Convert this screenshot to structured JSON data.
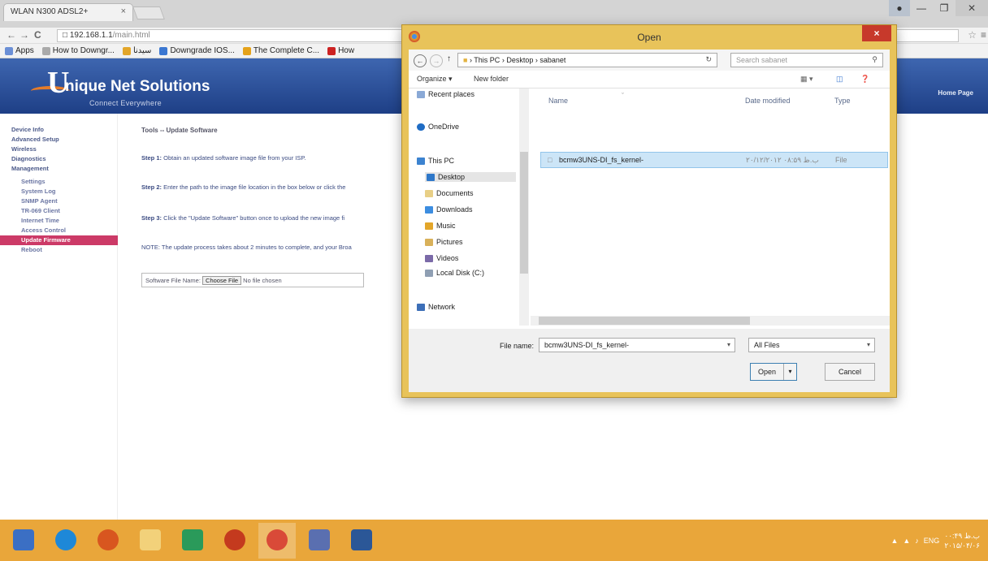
{
  "browser": {
    "tab_title": "WLAN N300 ADSL2+",
    "tab_close": "×",
    "url_host": "192.168.1.1",
    "url_path": "/main.html",
    "bookmarks": [
      {
        "label": "Apps",
        "color": "#6b8fd6"
      },
      {
        "label": "How to Downgr...",
        "color": "#aaaaaa"
      },
      {
        "label": "سيدنا",
        "color": "#e3a62a"
      },
      {
        "label": "Downgrade IOS...",
        "color": "#3b77d1"
      },
      {
        "label": "The Complete C...",
        "color": "#e5a21a"
      },
      {
        "label": "How",
        "color": "#cc2222"
      }
    ]
  },
  "router": {
    "brand_u": "U",
    "brand_rest": "nique Net Solutions",
    "slogan": "Connect Everywhere",
    "home_link": "Home Page",
    "sidebar": [
      {
        "label": "Device Info",
        "sub": false,
        "active": false
      },
      {
        "label": "Advanced Setup",
        "sub": false,
        "active": false
      },
      {
        "label": "Wireless",
        "sub": false,
        "active": false
      },
      {
        "label": "Diagnostics",
        "sub": false,
        "active": false
      },
      {
        "label": "Management",
        "sub": false,
        "active": false
      },
      {
        "label": "Settings",
        "sub": true,
        "active": false
      },
      {
        "label": "System Log",
        "sub": true,
        "active": false
      },
      {
        "label": "SNMP Agent",
        "sub": true,
        "active": false
      },
      {
        "label": "TR-069 Client",
        "sub": true,
        "active": false
      },
      {
        "label": "Internet Time",
        "sub": true,
        "active": false
      },
      {
        "label": "Access Control",
        "sub": true,
        "active": false
      },
      {
        "label": "Update Firmware",
        "sub": true,
        "active": true
      },
      {
        "label": "Reboot",
        "sub": true,
        "active": false
      }
    ],
    "breadcrumb": "Tools -- Update Software",
    "step1_label": "Step 1:",
    "step1_text": "Obtain an updated software image file from your ISP.",
    "step2_label": "Step 2:",
    "step2_text": "Enter the path to the image file location in the box below or click the",
    "step3_label": "Step 3:",
    "step3_text": "Click the \"Update Software\" button once to upload the new image fi",
    "note": "NOTE: The update process takes about 2 minutes to complete, and your Broa",
    "file_label": "Software File Name:",
    "choose_file": "Choose File",
    "no_file": "No file chosen"
  },
  "dialog": {
    "title": "Open",
    "close": "×",
    "back": "←",
    "forward": "→",
    "up": "↑",
    "path": [
      "This PC",
      "Desktop",
      "sabanet"
    ],
    "path_sep": "›",
    "refresh": "↻",
    "search_placeholder": "Search sabanet",
    "organize": "Organize ▾",
    "new_folder": "New folder",
    "nav": {
      "recent": "Recent places",
      "onedrive": "OneDrive",
      "thispc": "This PC",
      "desktop": "Desktop",
      "documents": "Documents",
      "downloads": "Downloads",
      "music": "Music",
      "pictures": "Pictures",
      "videos": "Videos",
      "localdisk": "Local Disk (C:)",
      "network": "Network"
    },
    "columns": {
      "name": "Name",
      "date": "Date modified",
      "type": "Type"
    },
    "file": {
      "name": "bcmw3UNS-DI_fs_kernel-",
      "date": "۲۰/۱۲/۲۰۱۲ ب.ظ ۰۸:۵۹",
      "type": "File"
    },
    "file_name_label": "File name:",
    "file_name_value": "bcmw3UNS-DI_fs_kernel-",
    "file_type": "All Files",
    "open_button": "Open",
    "cancel_button": "Cancel"
  },
  "taskbar": {
    "lang": "ENG",
    "time": "۰۰:۴۹ ب.ظ",
    "date": "۲۰۱۵/۰۴/۰۶"
  }
}
